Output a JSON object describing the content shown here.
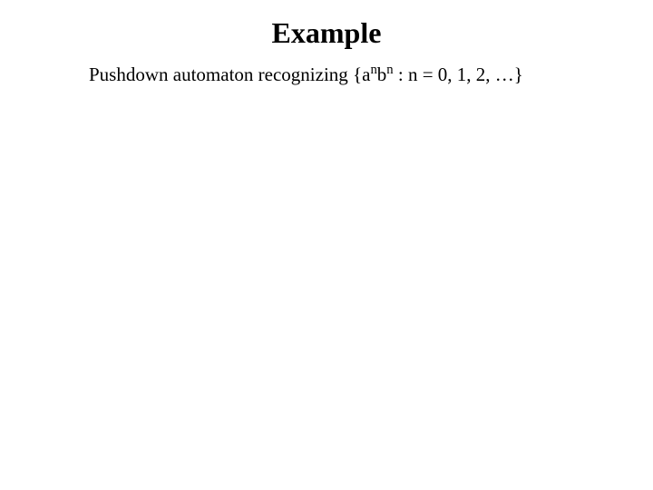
{
  "slide": {
    "title": "Example",
    "subtitle": {
      "prefix": "Pushdown automaton recognizing {a",
      "sup1": "n",
      "mid1": "b",
      "sup2": "n",
      "suffix": " : n = 0, 1, 2, …}"
    }
  }
}
